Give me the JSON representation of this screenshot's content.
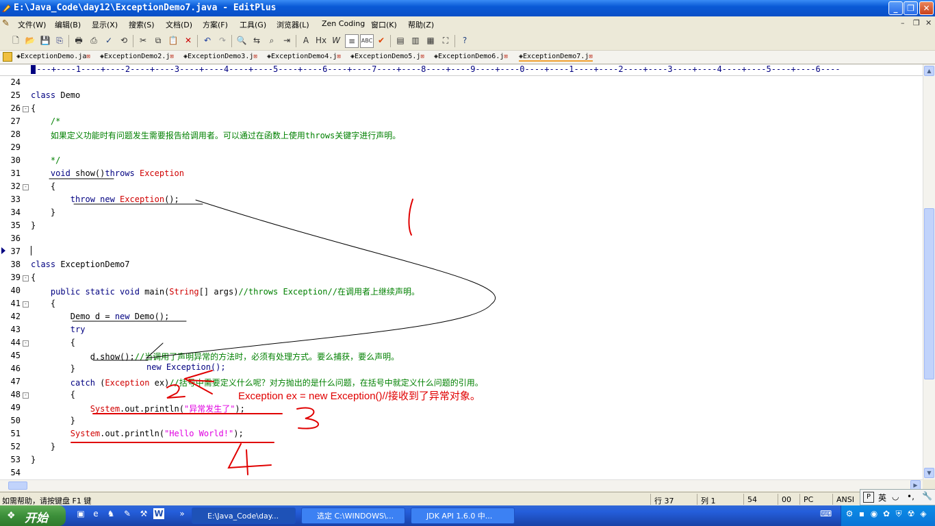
{
  "window": {
    "title": "E:\\Java_Code\\day12\\ExceptionDemo7.java - EditPlus"
  },
  "menu": [
    {
      "label": "文件(W)"
    },
    {
      "label": "编辑(B)"
    },
    {
      "label": "显示(X)"
    },
    {
      "label": "搜索(S)"
    },
    {
      "label": "文档(D)"
    },
    {
      "label": "方案(F)"
    },
    {
      "label": "工具(G)"
    },
    {
      "label": "浏览器(L)"
    },
    {
      "label": "Zen Coding"
    },
    {
      "label": "窗口(K)"
    },
    {
      "label": "帮助(Z)"
    }
  ],
  "tabs": [
    {
      "label": "ExceptionDemo.ja"
    },
    {
      "label": "ExceptionDemo2.j"
    },
    {
      "label": "ExceptionDemo3.j"
    },
    {
      "label": "ExceptionDemo4.j"
    },
    {
      "label": "ExceptionDemo5.j"
    },
    {
      "label": "ExceptionDemo6.j"
    },
    {
      "label": "ExceptionDemo7.j"
    }
  ],
  "ruler": "----+----1----+----2----+----3----+----4----+----5----+----6----+----7----+----8----+----9----+----0----+----1----+----2----+----3----+----4----+----5----+----6----",
  "editor": {
    "lines": [
      {
        "n": "24"
      },
      {
        "n": "25",
        "a": "class Demo"
      },
      {
        "n": "26",
        "a": "{"
      },
      {
        "n": "27",
        "c": "    /*"
      },
      {
        "n": "28",
        "c": "    如果定义功能时有问题发生需要报告给调用者。可以通过在函数上使用throws关键字进行声明。"
      },
      {
        "n": "29"
      },
      {
        "n": "30",
        "c": "    */"
      },
      {
        "n": "31",
        "k": "    void ",
        "a": "show()",
        "k2": "throws ",
        "r": "Exception"
      },
      {
        "n": "32",
        "a": "    {"
      },
      {
        "n": "33",
        "k": "        throw new ",
        "r": "Exception",
        "a": "();"
      },
      {
        "n": "34",
        "a": "    }"
      },
      {
        "n": "35",
        "a": "}"
      },
      {
        "n": "36"
      },
      {
        "n": "37"
      },
      {
        "n": "38",
        "a": "class ExceptionDemo7"
      },
      {
        "n": "39",
        "a": "{"
      },
      {
        "n": "40",
        "k": "    public static void ",
        "a": "main(",
        "r": "String",
        "a2": "[] args)",
        "c": "//throws Exception//在调用者上继续声明。"
      },
      {
        "n": "41",
        "a": "    {"
      },
      {
        "n": "42",
        "a": "        Demo d = ",
        "k": "new ",
        "a2": "Demo();"
      },
      {
        "n": "43",
        "k": "        try"
      },
      {
        "n": "44",
        "a": "        {"
      },
      {
        "n": "45",
        "a": "            d.show();",
        "c": "//当调用了声明异常的方法时，必须有处理方式。要么捕获，要么声明。"
      },
      {
        "n": "46",
        "a": "        }"
      },
      {
        "n": "47",
        "k": "        catch ",
        "a": "(",
        "r": "Exception",
        "a2": " ex)",
        "c": "//括号中需要定义什么呢？对方抛出的是什么问题，在括号中就定义什么问题的引用。"
      },
      {
        "n": "48",
        "a": "        {"
      },
      {
        "n": "49",
        "r": "            System",
        "a": ".out.println(",
        "s": "\"异常发生了\"",
        "a2": ");"
      },
      {
        "n": "50",
        "a": "        }"
      },
      {
        "n": "51",
        "r": "        System",
        "a": ".out.println(",
        "s": "\"Hello World!\"",
        "a2": ");"
      },
      {
        "n": "52",
        "a": "    }"
      },
      {
        "n": "53",
        "a": "}"
      },
      {
        "n": "54"
      }
    ],
    "annotation_line46": "new Exception();",
    "annotation_text": "Exception ex = new Exception()//接收到了异常对象。"
  },
  "statusbar": {
    "help": "如需帮助，请按键盘 F1 键",
    "row": "行 37",
    "col": "列 1",
    "count": "54",
    "ins": "00",
    "mode": "PC",
    "encoding": "ANSI"
  },
  "ime": {
    "label": "英"
  },
  "taskbar": {
    "start": "开始",
    "tasks": [
      {
        "label": "E:\\Java_Code\\day..."
      },
      {
        "label": "选定 C:\\WINDOWS\\..."
      },
      {
        "label": "JDK API 1.6.0 中..."
      }
    ]
  }
}
